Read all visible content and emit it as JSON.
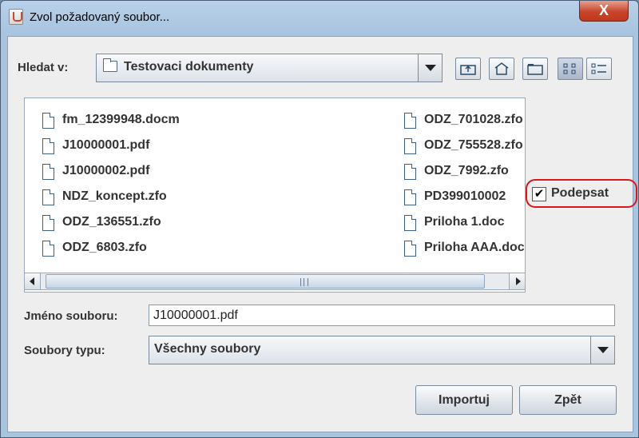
{
  "window": {
    "title": "Zvol požadovaný soubor...",
    "close_glyph": "X"
  },
  "lookin": {
    "label": "Hledat v:",
    "value": "Testovaci dokumenty",
    "icon": "folder-icon"
  },
  "toolbar": {
    "buttons": [
      {
        "name": "up-one-level",
        "icon": "folder-up-icon"
      },
      {
        "name": "home",
        "icon": "home-icon"
      },
      {
        "name": "new-folder",
        "icon": "new-folder-icon"
      },
      {
        "name": "list-view",
        "icon": "list-view-icon",
        "active": true
      },
      {
        "name": "details-view",
        "icon": "details-view-icon",
        "active": false
      }
    ]
  },
  "files": {
    "column1": [
      "fm_12399948.docm",
      "J10000001.pdf",
      "J10000002.pdf",
      "NDZ_koncept.zfo",
      "ODZ_136551.zfo",
      "ODZ_6803.zfo"
    ],
    "column2": [
      "ODZ_701028.zfo",
      "ODZ_755528.zfo",
      "ODZ_7992.zfo",
      "PD399010002",
      "Priloha 1.doc",
      "Priloha AAA.doc"
    ]
  },
  "sign": {
    "label": "Podepsat",
    "checked": true,
    "check_glyph": "✔",
    "highlight_color": "#d8171b"
  },
  "filename": {
    "label": "Jméno souboru:",
    "value": "J10000001.pdf"
  },
  "filetype": {
    "label": "Soubory typu:",
    "value": "Všechny soubory"
  },
  "buttons": {
    "import": "Importuj",
    "back": "Zpět"
  }
}
